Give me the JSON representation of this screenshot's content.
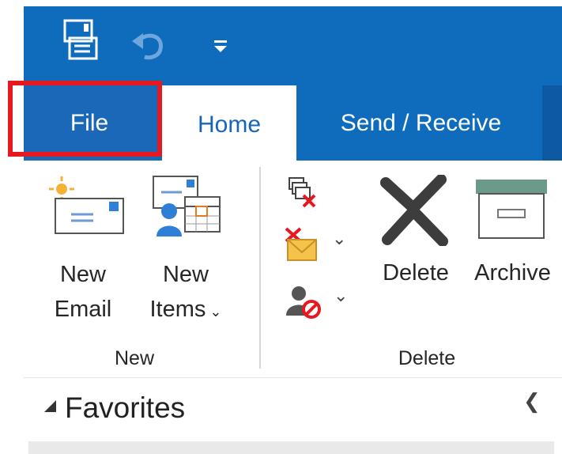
{
  "quick_access": {
    "icons": [
      "save-all-icon",
      "undo-icon",
      "customize-dropdown-icon"
    ]
  },
  "tabs": {
    "file": "File",
    "home": "Home",
    "send_receive": "Send / Receive"
  },
  "ribbon": {
    "new_email": {
      "line1": "New",
      "line2": "Email"
    },
    "new_items": {
      "line1": "New",
      "line2": "Items"
    },
    "delete": "Delete",
    "archive": "Archive",
    "group_new": "New",
    "group_delete": "Delete"
  },
  "nav": {
    "favorites": "Favorites"
  },
  "colors": {
    "title_blue": "#0f6cbd",
    "highlight_red": "#e5191f"
  }
}
